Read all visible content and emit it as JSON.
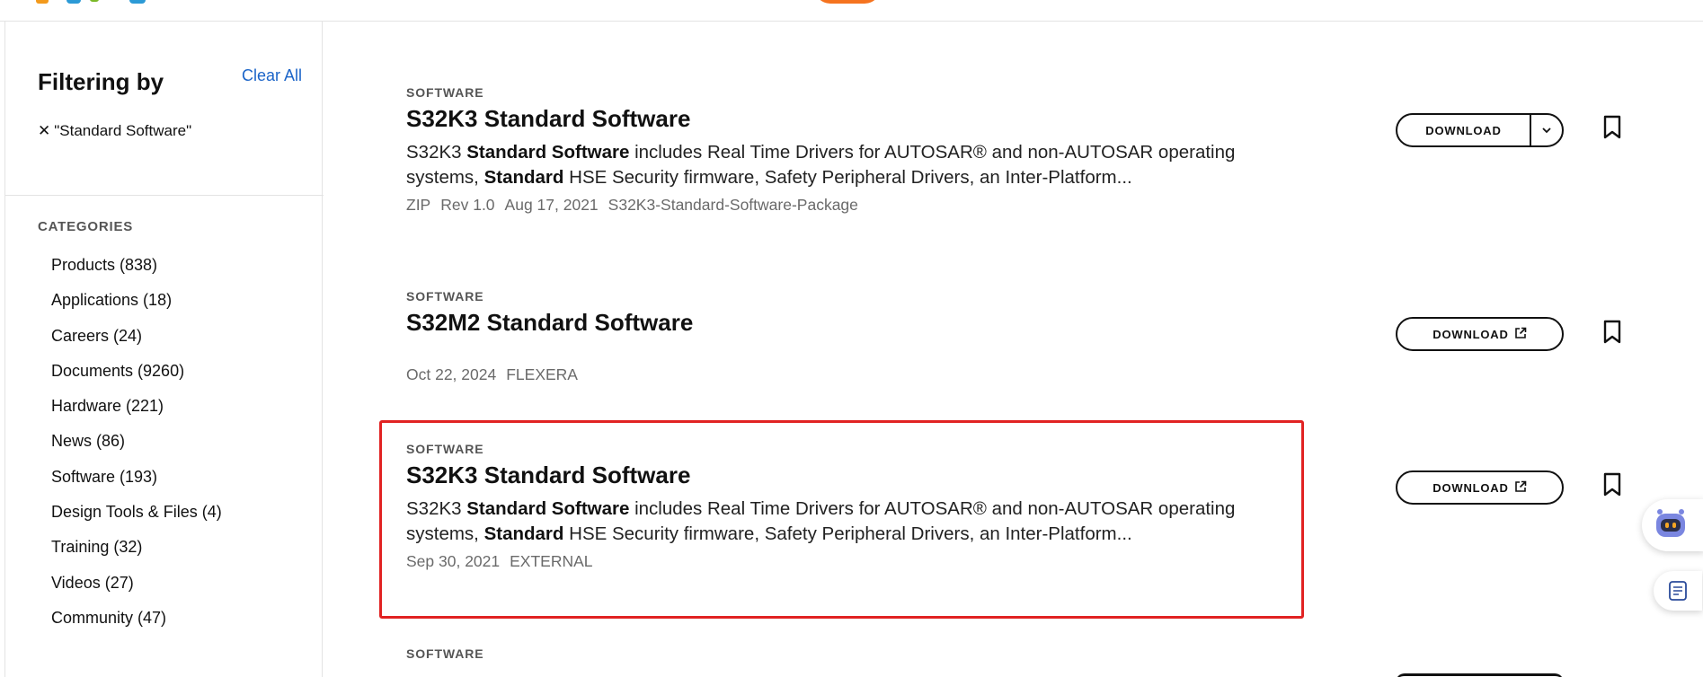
{
  "sidebar": {
    "filter_title": "Filtering by",
    "clear_all": "Clear All",
    "active_filter": "\"Standard Software\"",
    "categories_title": "CATEGORIES",
    "categories": [
      "Products (838)",
      "Applications (18)",
      "Careers (24)",
      "Documents (9260)",
      "Hardware (221)",
      "News (86)",
      "Software (193)",
      "Design Tools & Files (4)",
      "Training (32)",
      "Videos (27)",
      "Community (47)"
    ]
  },
  "results": [
    {
      "type": "SOFTWARE",
      "title": "S32K3 Standard Software",
      "desc_1": "S32K3 ",
      "desc_2": "Standard Software",
      "desc_3": " includes Real Time Drivers for AUTOSAR® and non-AUTOSAR operating systems, ",
      "desc_4": "Standard",
      "desc_5": " HSE Security firmware, Safety Peripheral Drivers, an Inter-Platform...",
      "meta": [
        "ZIP",
        "Rev 1.0",
        "Aug 17, 2021",
        "S32K3-Standard-Software-Package"
      ],
      "download_label": "DOWNLOAD"
    },
    {
      "type": "SOFTWARE",
      "title": "S32M2 Standard Software",
      "meta": [
        "Oct 22, 2024",
        "FLEXERA"
      ],
      "download_label": "DOWNLOAD"
    },
    {
      "type": "SOFTWARE",
      "title": "S32K3 Standard Software",
      "desc_1": "S32K3 ",
      "desc_2": "Standard Software",
      "desc_3": " includes Real Time Drivers for AUTOSAR® and non-AUTOSAR operating systems, ",
      "desc_4": "Standard",
      "desc_5": " HSE Security firmware, Safety Peripheral Drivers, an Inter-Platform...",
      "meta": [
        "Sep 30, 2021",
        "EXTERNAL"
      ],
      "download_label": "DOWNLOAD"
    },
    {
      "type": "SOFTWARE"
    }
  ],
  "colors": {
    "link": "#1b64c8",
    "highlight_border": "#e12222",
    "brand_orange": "#f5731f"
  },
  "icons": [
    "close-icon",
    "chevron-down-icon",
    "external-link-icon",
    "bookmark-icon",
    "chat-bot-icon",
    "notes-icon"
  ]
}
